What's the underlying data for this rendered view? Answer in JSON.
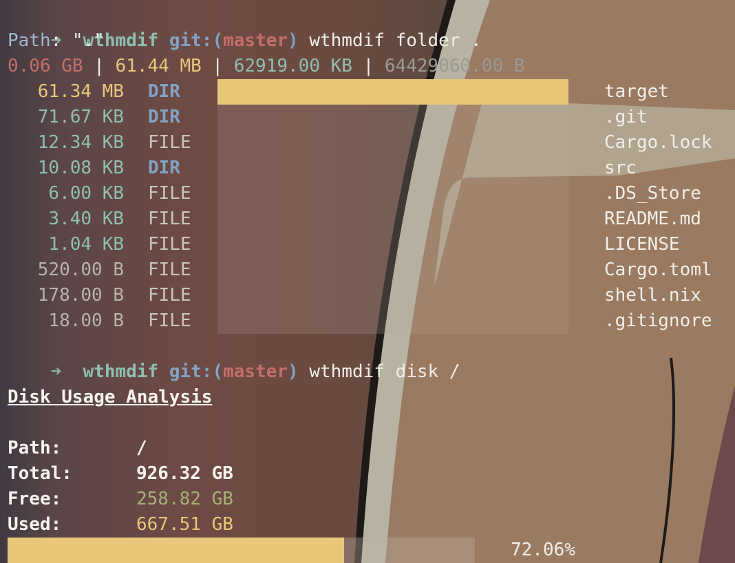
{
  "prompt1": {
    "arrow": "➜",
    "dir": "wthmdif",
    "git_prefix": "git:(",
    "branch": "master",
    "git_suffix": ")",
    "command": "wthmdif folder ."
  },
  "folder": {
    "path_label": "Path",
    "path_value": ": \".\"",
    "totals": [
      {
        "text": "0.06 GB",
        "color": "#c46f6a"
      },
      {
        "text": "61.44 MB",
        "color": "#e8c67a"
      },
      {
        "text": "62919.00 KB",
        "color": "#8fbfb2"
      },
      {
        "text": "64429060.00 B",
        "color": "#9c9a96"
      }
    ],
    "separator": " | ",
    "entries": [
      {
        "size": "61.34 MB",
        "size_color": "#e8c67a",
        "type": "DIR",
        "name": "target",
        "fraction": 1.0
      },
      {
        "size": "71.67 KB",
        "size_color": "#8fbfb2",
        "type": "DIR",
        "name": ".git",
        "fraction": 0.0
      },
      {
        "size": "12.34 KB",
        "size_color": "#8fbfb2",
        "type": "FILE",
        "name": "Cargo.lock",
        "fraction": 0.0
      },
      {
        "size": "10.08 KB",
        "size_color": "#8fbfb2",
        "type": "DIR",
        "name": "src",
        "fraction": 0.0
      },
      {
        "size": "6.00 KB",
        "size_color": "#8fbfb2",
        "type": "FILE",
        "name": ".DS_Store",
        "fraction": 0.0
      },
      {
        "size": "3.40 KB",
        "size_color": "#8fbfb2",
        "type": "FILE",
        "name": "README.md",
        "fraction": 0.0
      },
      {
        "size": "1.04 KB",
        "size_color": "#8fbfb2",
        "type": "FILE",
        "name": "LICENSE",
        "fraction": 0.0
      },
      {
        "size": "520.00 B",
        "size_color": "#b8b4ad",
        "type": "FILE",
        "name": "Cargo.toml",
        "fraction": 0.0
      },
      {
        "size": "178.00 B",
        "size_color": "#b8b4ad",
        "type": "FILE",
        "name": "shell.nix",
        "fraction": 0.0
      },
      {
        "size": "18.00 B",
        "size_color": "#b8b4ad",
        "type": "FILE",
        "name": ".gitignore",
        "fraction": 0.0
      }
    ],
    "dir_color": "#82a3c4",
    "file_color": "#c9c4bc"
  },
  "prompt2": {
    "arrow": "➜",
    "dir": "wthmdif",
    "git_prefix": "git:(",
    "branch": "master",
    "git_suffix": ")",
    "command": "wthmdif disk /"
  },
  "disk": {
    "heading": "Disk Usage Analysis",
    "path_label": "Path:",
    "path_value": "/",
    "total_label": "Total:",
    "total_value": "926.32 GB",
    "free_label": "Free:",
    "free_value": "258.82 GB",
    "used_label": "Used:",
    "used_value": "667.51 GB",
    "percent_text": "72.06%",
    "used_fraction": 0.7206
  }
}
